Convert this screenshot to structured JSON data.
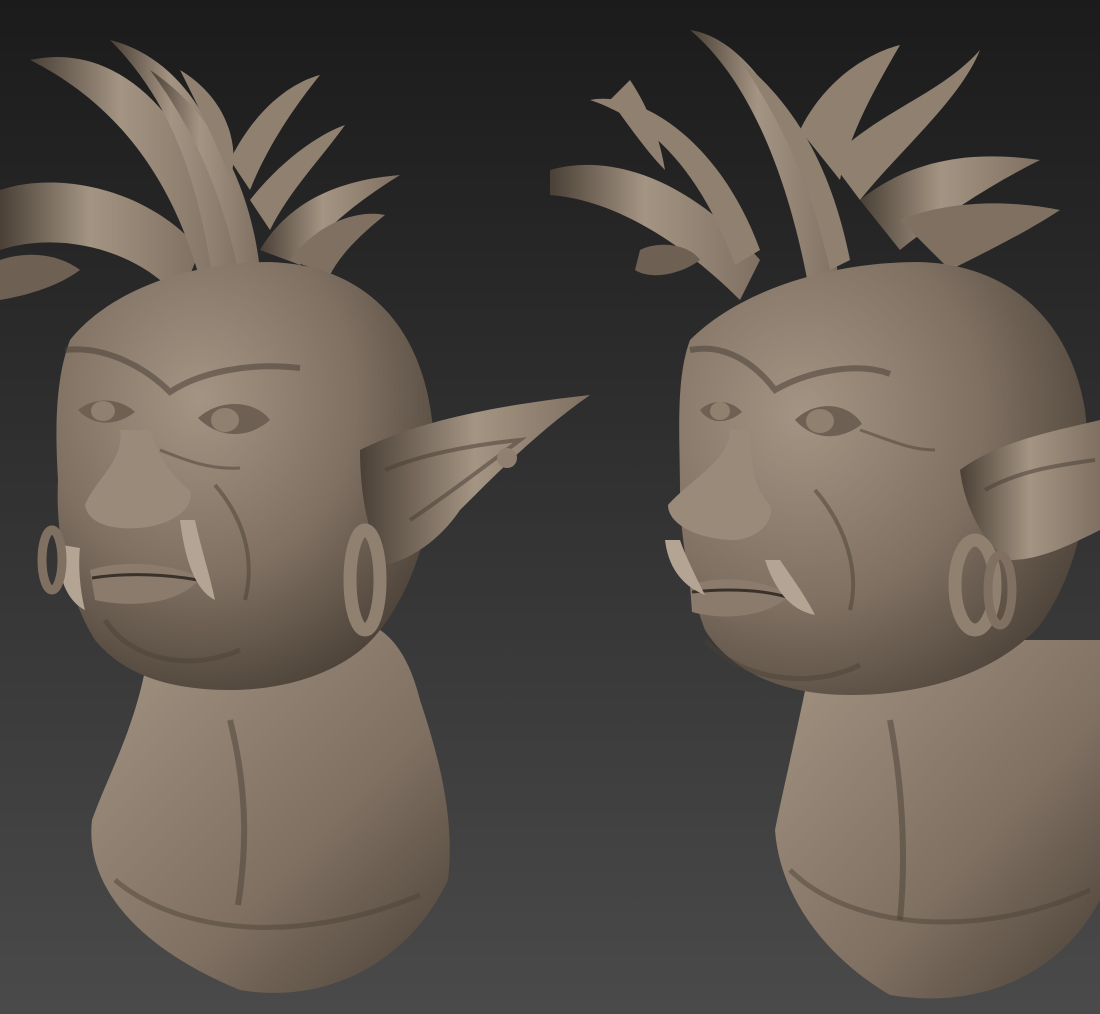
{
  "scene": {
    "subject": "two-sculpted-troll-bust-views",
    "views": [
      {
        "name": "three-quarter-left-view"
      },
      {
        "name": "side-left-view"
      }
    ]
  },
  "colors": {
    "background_top": "#1b1b1b",
    "background_bottom": "#4a4a4a",
    "clay_light": "#a49483",
    "clay_base": "#7f7062",
    "clay_shadow": "#4a4036",
    "clay_dark": "#2e2721"
  }
}
